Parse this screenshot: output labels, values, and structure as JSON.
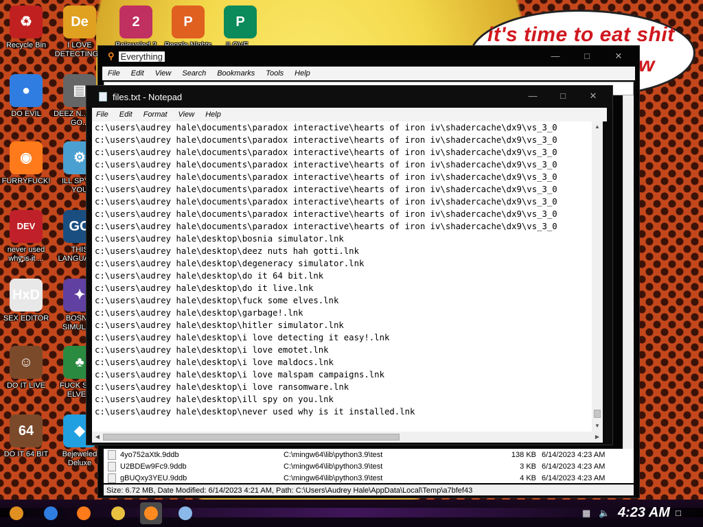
{
  "wallpaper": {
    "speech_line1": "it's time to eat shit",
    "speech_line2": "w"
  },
  "desktop_icons": [
    {
      "label": "Recycle Bin",
      "icon": "recycle-bin-icon",
      "glyph": "♻",
      "color": "#c02020"
    },
    {
      "label": "I LOVE DETECTING...",
      "icon": "detect-it-easy-icon",
      "glyph": "De",
      "color": "#e0a020"
    },
    {
      "label": "Bejeweled 2",
      "icon": "bejeweled-2-icon",
      "glyph": "2",
      "color": "#c03060"
    },
    {
      "label": "Peggle Nights",
      "icon": "peggle-nights-icon",
      "glyph": "P",
      "color": "#e06020"
    },
    {
      "label": "ILOVE...",
      "icon": "publisher-icon",
      "glyph": "P",
      "color": "#0b8a5b"
    },
    {
      "label": "DO EVIL",
      "icon": "chrome-icon",
      "glyph": "●",
      "color": "#2f7de0"
    },
    {
      "label": "DEEZ N... HAH GO...",
      "icon": "deez-nuts-icon",
      "glyph": "▤",
      "color": "#666"
    },
    {
      "label": "FURRYFUCK!",
      "icon": "firefox-icon",
      "glyph": "◉",
      "color": "#ff7a1a"
    },
    {
      "label": "ILL SPY ... YOU",
      "icon": "spy-icon",
      "glyph": "⚙",
      "color": "#4aa0d0"
    },
    {
      "label": "never used why is it ...",
      "icon": "dev-cpp-icon",
      "glyph": "DEV C++",
      "color": "#c0202a"
    },
    {
      "label": "THIS LANGUAG...",
      "icon": "go-language-icon",
      "glyph": "GO",
      "color": "#1a4e80"
    },
    {
      "label": "SEX EDITOR",
      "icon": "hxd-icon",
      "glyph": "HxD",
      "color": "#e8e8e8"
    },
    {
      "label": "BOSN... SIMULA...",
      "icon": "bosnia-simulator-icon",
      "glyph": "✦",
      "color": "#6040a0"
    },
    {
      "label": "DO IT LIVE",
      "icon": "portrait-icon",
      "glyph": "☺",
      "color": "#7a4a2a"
    },
    {
      "label": "FUCK SO... ELVE...",
      "icon": "elves-icon",
      "glyph": "♣",
      "color": "#2a8a40"
    },
    {
      "label": "DO IT 64 BIT",
      "icon": "portrait-64-icon",
      "glyph": "64",
      "color": "#7a4a2a"
    },
    {
      "label": "Bejeweled Deluxe",
      "icon": "bejeweled-deluxe-icon",
      "glyph": "◆",
      "color": "#20a0e0"
    }
  ],
  "everything_window": {
    "title": "Everything",
    "menu": [
      "File",
      "Edit",
      "View",
      "Search",
      "Bookmarks",
      "Tools",
      "Help"
    ],
    "search_value": "",
    "results": [
      {
        "name": "4yo752aXtk.9ddb",
        "path": "C:\\mingw64\\lib\\python3.9\\test",
        "size": "138 KB",
        "date": "6/14/2023 4:23 AM"
      },
      {
        "name": "U2BDEw9Fc9.9ddb",
        "path": "C:\\mingw64\\lib\\python3.9\\test",
        "size": "3 KB",
        "date": "6/14/2023 4:23 AM"
      },
      {
        "name": "gBUQxy3YEU.9ddb",
        "path": "C:\\mingw64\\lib\\python3.9\\test",
        "size": "4 KB",
        "date": "6/14/2023 4:23 AM"
      }
    ],
    "status": "Size: 6.72 MB, Date Modified: 6/14/2023 4:21 AM, Path: C:\\Users\\Audrey Hale\\AppData\\Local\\Temp\\a7bfef43"
  },
  "notepad_window": {
    "title": "files.txt - Notepad",
    "menu": [
      "File",
      "Edit",
      "Format",
      "View",
      "Help"
    ],
    "lines": [
      "c:\\users\\audrey hale\\documents\\paradox interactive\\hearts of iron iv\\shadercache\\dx9\\vs_3_0",
      "c:\\users\\audrey hale\\documents\\paradox interactive\\hearts of iron iv\\shadercache\\dx9\\vs_3_0",
      "c:\\users\\audrey hale\\documents\\paradox interactive\\hearts of iron iv\\shadercache\\dx9\\vs_3_0",
      "c:\\users\\audrey hale\\documents\\paradox interactive\\hearts of iron iv\\shadercache\\dx9\\vs_3_0",
      "c:\\users\\audrey hale\\documents\\paradox interactive\\hearts of iron iv\\shadercache\\dx9\\vs_3_0",
      "c:\\users\\audrey hale\\documents\\paradox interactive\\hearts of iron iv\\shadercache\\dx9\\vs_3_0",
      "c:\\users\\audrey hale\\documents\\paradox interactive\\hearts of iron iv\\shadercache\\dx9\\vs_3_0",
      "c:\\users\\audrey hale\\documents\\paradox interactive\\hearts of iron iv\\shadercache\\dx9\\vs_3_0",
      "c:\\users\\audrey hale\\documents\\paradox interactive\\hearts of iron iv\\shadercache\\dx9\\vs_3_0",
      "c:\\users\\audrey hale\\desktop\\bosnia simulator.lnk",
      "c:\\users\\audrey hale\\desktop\\deez nuts hah gotti.lnk",
      "c:\\users\\audrey hale\\desktop\\degeneracy simulator.lnk",
      "c:\\users\\audrey hale\\desktop\\do it 64 bit.lnk",
      "c:\\users\\audrey hale\\desktop\\do it live.lnk",
      "c:\\users\\audrey hale\\desktop\\fuck some elves.lnk",
      "c:\\users\\audrey hale\\desktop\\garbage!.lnk",
      "c:\\users\\audrey hale\\desktop\\hitler simulator.lnk",
      "c:\\users\\audrey hale\\desktop\\i love detecting it easy!.lnk",
      "c:\\users\\audrey hale\\desktop\\i love emotet.lnk",
      "c:\\users\\audrey hale\\desktop\\i love maldocs.lnk",
      "c:\\users\\audrey hale\\desktop\\i love malspam campaigns.lnk",
      "c:\\users\\audrey hale\\desktop\\i love ransomware.lnk",
      "c:\\users\\audrey hale\\desktop\\ill spy on you.lnk",
      "c:\\users\\audrey hale\\desktop\\never used why is it installed.lnk"
    ]
  },
  "taskbar": {
    "clock": "4:23 AM",
    "items": [
      {
        "icon": "start-button-icon",
        "color": "#e09020"
      },
      {
        "icon": "chrome-taskbar-icon",
        "color": "#2f7de0"
      },
      {
        "icon": "firefox-taskbar-icon",
        "color": "#ff7a1a"
      },
      {
        "icon": "file-explorer-taskbar-icon",
        "color": "#e8c040"
      },
      {
        "icon": "everything-taskbar-icon",
        "color": "#ff8a20"
      },
      {
        "icon": "notepad-taskbar-icon",
        "color": "#8ab8e8"
      }
    ]
  }
}
